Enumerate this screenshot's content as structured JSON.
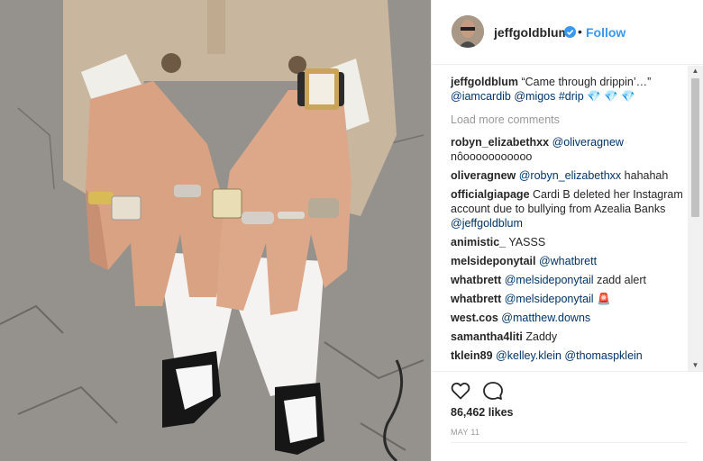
{
  "post": {
    "username": "jeffgoldblum",
    "dot": "•",
    "follow_label": "Follow",
    "caption": {
      "username": "jeffgoldblum",
      "text": "“Came through drippin’…”",
      "mentions": "@iamcardib @migos #drip",
      "emoji": "💎 💎 💎"
    },
    "load_more_label": "Load more comments",
    "comments": [
      {
        "user": "robyn_elizabethxx",
        "mention": "@oliveragnew",
        "text": "nôooooooooooo"
      },
      {
        "user": "oliveragnew",
        "mention": "@robyn_elizabethxx",
        "text": "hahahah"
      },
      {
        "user": "officialgiapage",
        "mention": "",
        "text": "Cardi B deleted her Instagram account due to bullying from Azealia Banks",
        "mention_after": "@jeffgoldblum"
      },
      {
        "user": "animistic_",
        "mention": "",
        "text": "YASSS"
      },
      {
        "user": "melsideponytail",
        "mention": "@whatbrett",
        "text": ""
      },
      {
        "user": "whatbrett",
        "mention": "@melsideponytail",
        "text": "zadd alert"
      },
      {
        "user": "whatbrett",
        "mention": "@melsideponytail",
        "text": "🚨"
      },
      {
        "user": "west.cos",
        "mention": "@matthew.downs",
        "text": ""
      },
      {
        "user": "samantha4liti",
        "mention": "",
        "text": "Zaddy"
      },
      {
        "user": "tklein89",
        "mention": "@kelley.klein @thomaspklein",
        "text": ""
      }
    ],
    "likes": "86,462 likes",
    "date": "MAY 11"
  },
  "icons": {
    "like": "heart-outline-icon",
    "comment": "speech-bubble-icon",
    "verified": "verified-badge-icon"
  },
  "colors": {
    "link": "#3897f0",
    "mention": "#003569",
    "muted": "#999999",
    "text": "#262626"
  }
}
